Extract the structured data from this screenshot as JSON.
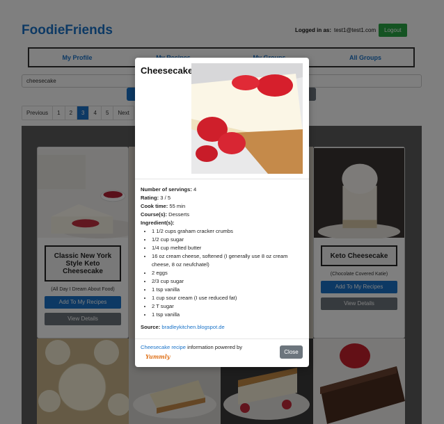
{
  "app": {
    "brand": "FoodieFriends"
  },
  "header": {
    "login_label": "Logged in as:",
    "login_user": "test1@test1.com",
    "logout_label": "Logout"
  },
  "nav": {
    "items": [
      "My Profile",
      "My Recipes",
      "My Groups",
      "All Groups"
    ]
  },
  "search": {
    "value": "cheesecake"
  },
  "pagination": {
    "prev": "Previous",
    "pages": [
      "1",
      "2",
      "3",
      "4",
      "5"
    ],
    "active_page": "3",
    "next": "Next"
  },
  "cards": [
    {
      "title": "Classic New York Style Keto Cheesecake",
      "author": "(All Day I Dream About Food)",
      "add_label": "Add To My Recipes",
      "view_label": "View Details"
    },
    {
      "title": "Keto Cheesecake",
      "author": "(Chocolate Covered Katie)",
      "add_label": "Add To My Recipes",
      "view_label": "View Details"
    }
  ],
  "modal": {
    "title": "Cheesecake",
    "servings_label": "Number of servings:",
    "servings": "4",
    "rating_label": "Rating:",
    "rating": "3 / 5",
    "cook_time_label": "Cook time:",
    "cook_time": "55 min",
    "course_label": "Course(s):",
    "course": "Desserts",
    "ingredients_label": "Ingredient(s):",
    "ingredients": [
      "1 1/2 cups graham cracker crumbs",
      "1/2 cup sugar",
      "1/4 cup melted butter",
      "16 oz cream cheese, softened (I generally use 8 oz cream cheese, 8 oz neufchatel)",
      "2 eggs",
      "2/3 cup sugar",
      "1 tsp vanilla",
      "1 cup sour cream (I use reduced fat)",
      "2 T sugar",
      "1 tsp vanilla"
    ],
    "source_label": "Source:",
    "source": "bradleykitchen.blogspot.de",
    "footer_link": "Cheesecake recipe",
    "footer_text": " information powered by",
    "yummly": "Yummly",
    "close_label": "Close"
  },
  "colors": {
    "brand": "#1a73c8",
    "logout": "#28a745",
    "close": "#6c757d"
  }
}
